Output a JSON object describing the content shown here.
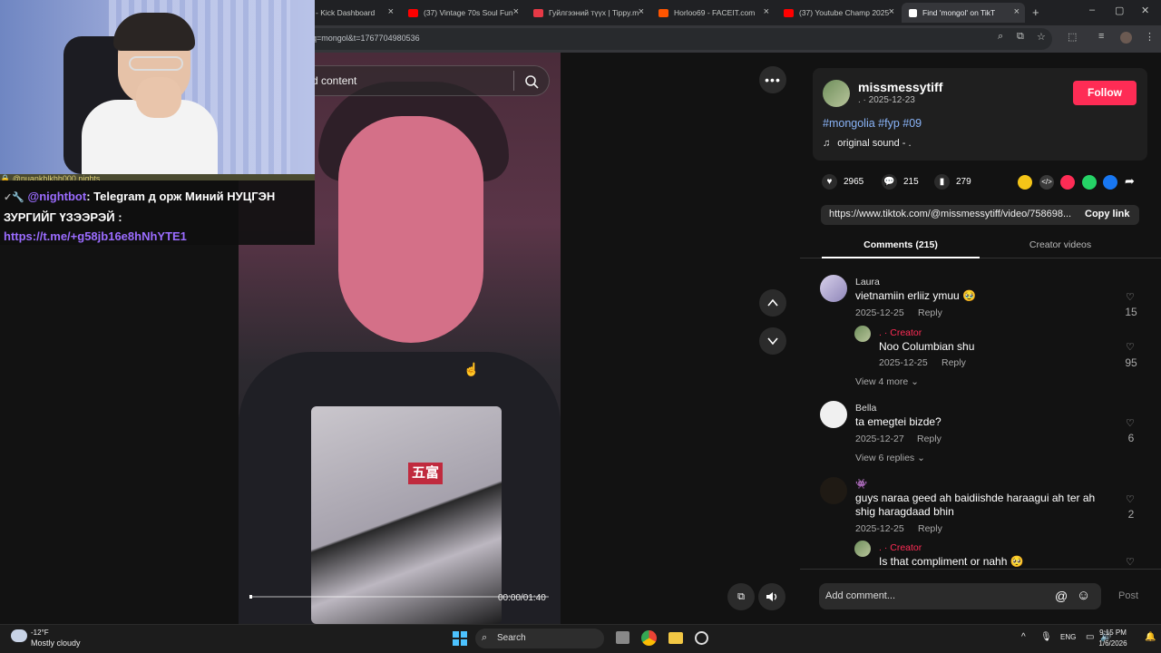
{
  "browser": {
    "tabs": [
      {
        "label": "- Kick Dashboard",
        "color": "#53fc18"
      },
      {
        "label": "(37) Vintage 70s Soul Fun",
        "color": "#ff0000"
      },
      {
        "label": "Гуйлгээний түүх | Tippy.m",
        "color": "#e63946"
      },
      {
        "label": "Horloo69 - FACEIT.com",
        "color": "#ff5500"
      },
      {
        "label": "(37) Youtube Champ 2025",
        "color": "#ff0000"
      },
      {
        "label": "Find 'mongol' on TikT",
        "color": "#ffffff"
      }
    ],
    "url": "q=mongol&t=1767704980536"
  },
  "stream": {
    "chat_strip": "🔒 @nuankhlkhh000 nights",
    "chat_user": "@nightbot",
    "chat_message": ": Telegram д орж Миний НУЦГЭН ЗУРГИЙГ ҮЗЭЭРЭЙ :",
    "chat_link": "https://t.me/+g58jb16e8hNhYTE1"
  },
  "video": {
    "search_placeholder": "d content",
    "time": "00:00/01:40",
    "progress": 0.0,
    "shirt_sign": "五富"
  },
  "post": {
    "username": "missmessytiff",
    "nick_date": ". · 2025-12-23",
    "follow_label": "Follow",
    "hashtags": "#mongolia #fyp #09",
    "sound": "original sound - .",
    "likes": "2965",
    "comments": "215",
    "saves": "279",
    "link": "https://www.tiktok.com/@missmessytiff/video/758698...",
    "copy_label": "Copy link"
  },
  "tabs": {
    "comments": "Comments (215)",
    "creator": "Creator videos"
  },
  "comments": [
    {
      "name": "Laura",
      "text": "vietnamiin erliiz ymuu 🥹",
      "date": "2025-12-25",
      "reply": "Reply",
      "likes": "15"
    },
    {
      "name": ". · Creator",
      "text": "Noo Columbian shu",
      "date": "2025-12-25",
      "reply": "Reply",
      "likes": "95"
    },
    {
      "name": "Bella",
      "text": "ta emegtei bizde?",
      "date": "2025-12-27",
      "reply": "Reply",
      "likes": "6"
    },
    {
      "name": "👾",
      "text": "guys naraa geed ah baidiishde haraagui ah ter ah shig haragdaad bhin",
      "date": "2025-12-25",
      "reply": "Reply",
      "likes": "2"
    },
    {
      "name": ". · Creator",
      "text": "Is that compliment or nahh 🥺",
      "date": "",
      "reply": "",
      "likes": ""
    }
  ],
  "view_more": [
    "View 4 more",
    "View 6 replies"
  ],
  "comment_input": {
    "placeholder": "Add comment...",
    "post_label": "Post"
  },
  "taskbar": {
    "temp": "-12°F",
    "weather": "Mostly cloudy",
    "search": "Search",
    "lang": "ENG",
    "time": "9:15 PM",
    "date": "1/6/2026"
  }
}
